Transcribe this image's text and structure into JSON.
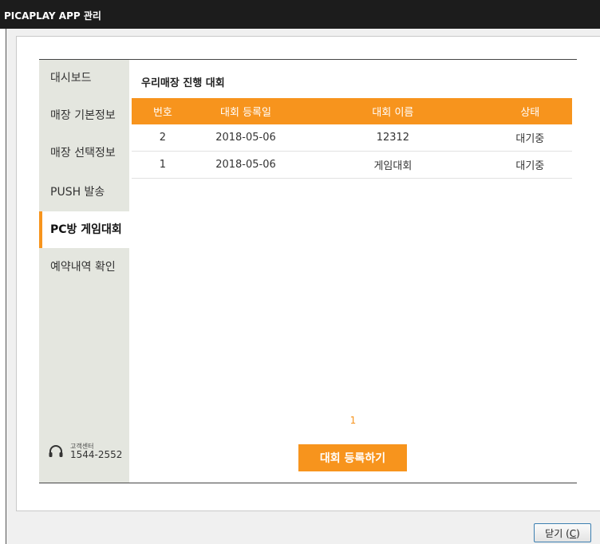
{
  "window": {
    "title": "PICAPLAY APP 관리"
  },
  "sidebar": {
    "items": [
      {
        "label": "대시보드"
      },
      {
        "label": "매장 기본정보"
      },
      {
        "label": "매장 선택정보"
      },
      {
        "label": "PUSH 발송"
      },
      {
        "label": "PC방 게임대회",
        "active": true
      },
      {
        "label": "예약내역 확인"
      }
    ],
    "support": {
      "title": "고객센터",
      "phone": "1544-2552"
    }
  },
  "main": {
    "title": "우리매장 진행 대회",
    "columns": [
      "번호",
      "대회 등록일",
      "대회 이름",
      "상태"
    ],
    "rows": [
      [
        "2",
        "2018-05-06",
        "12312",
        "대기중"
      ],
      [
        "1",
        "2018-05-06",
        "게임대회",
        "대기중"
      ]
    ],
    "pagination": {
      "current": "1"
    },
    "register_label": "대회 등록하기"
  },
  "footer": {
    "close_label": "닫기 (",
    "close_key": "C",
    "close_suffix": ")"
  },
  "colors": {
    "accent": "#f7941d",
    "sidebar_bg": "#e4e6df",
    "titlebar_bg": "#1c1c1c"
  },
  "icons": {
    "support": "headset-icon"
  }
}
